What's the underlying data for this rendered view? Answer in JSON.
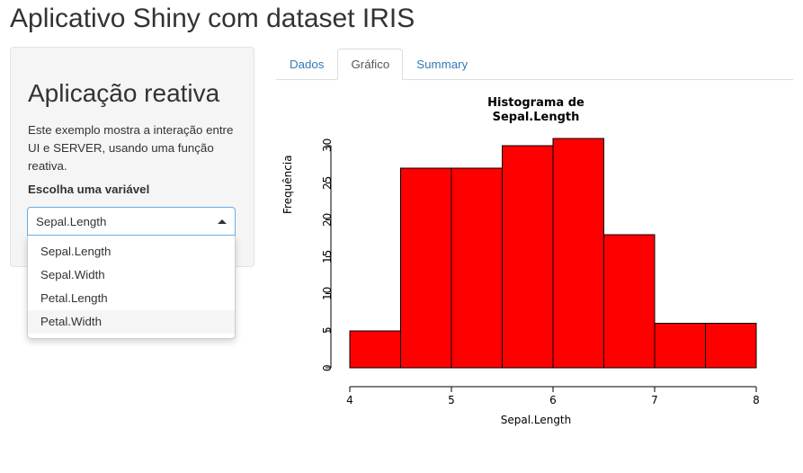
{
  "app": {
    "title": "Aplicativo Shiny com dataset IRIS"
  },
  "sidebar": {
    "heading": "Aplicação reativa",
    "description": "Este exemplo mostra a interação entre UI e SERVER, usando uma função reativa.",
    "field_label": "Escolha uma variável",
    "select": {
      "value": "Sepal.Length",
      "caret_icon": "caret-up-icon",
      "expanded": true,
      "options": [
        {
          "label": "Sepal.Length",
          "active": false
        },
        {
          "label": "Sepal.Width",
          "active": false
        },
        {
          "label": "Petal.Length",
          "active": false
        },
        {
          "label": "Petal.Width",
          "active": true
        }
      ]
    }
  },
  "tabs": [
    {
      "label": "Dados",
      "active": false
    },
    {
      "label": "Gráfico",
      "active": true
    },
    {
      "label": "Summary",
      "active": false
    }
  ],
  "colors": {
    "bar_fill": "#ff0000",
    "bar_border": "#000000",
    "axis": "#000000",
    "link": "#337ab7",
    "panel_bg": "#f5f5f5",
    "panel_border": "#e3e3e3",
    "focus_border": "#66afe9"
  },
  "chart_data": {
    "type": "bar",
    "title": "Histograma de Sepal.Length",
    "title_lines": [
      "Histograma de",
      "Sepal.Length"
    ],
    "xlabel": "Sepal.Length",
    "ylabel": "Frequência",
    "xlim": [
      4,
      8
    ],
    "ylim": [
      0,
      31
    ],
    "xticks": [
      4,
      5,
      6,
      7,
      8
    ],
    "yticks": [
      0,
      5,
      10,
      15,
      20,
      25,
      30
    ],
    "grid": false,
    "legend": null,
    "bin_width": 0.5,
    "bin_edges": [
      4.0,
      4.5,
      5.0,
      5.5,
      6.0,
      6.5,
      7.0,
      7.5,
      8.0
    ],
    "categories": [
      "4.0-4.5",
      "4.5-5.0",
      "5.0-5.5",
      "5.5-6.0",
      "6.0-6.5",
      "6.5-7.0",
      "7.0-7.5",
      "7.5-8.0"
    ],
    "values": [
      5,
      27,
      27,
      30,
      31,
      18,
      6,
      6
    ]
  }
}
